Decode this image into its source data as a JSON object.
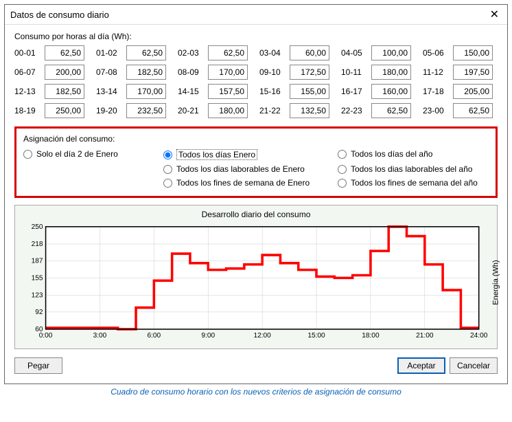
{
  "window": {
    "title": "Datos de consumo diario",
    "close": "✕"
  },
  "hourly": {
    "label": "Consumo por horas al día (Wh):",
    "rows": [
      {
        "h": "00-01",
        "v": "62,50"
      },
      {
        "h": "01-02",
        "v": "62,50"
      },
      {
        "h": "02-03",
        "v": "62,50"
      },
      {
        "h": "03-04",
        "v": "60,00"
      },
      {
        "h": "04-05",
        "v": "100,00"
      },
      {
        "h": "05-06",
        "v": "150,00"
      },
      {
        "h": "06-07",
        "v": "200,00"
      },
      {
        "h": "07-08",
        "v": "182,50"
      },
      {
        "h": "08-09",
        "v": "170,00"
      },
      {
        "h": "09-10",
        "v": "172,50"
      },
      {
        "h": "10-11",
        "v": "180,00"
      },
      {
        "h": "11-12",
        "v": "197,50"
      },
      {
        "h": "12-13",
        "v": "182,50"
      },
      {
        "h": "13-14",
        "v": "170,00"
      },
      {
        "h": "14-15",
        "v": "157,50"
      },
      {
        "h": "15-16",
        "v": "155,00"
      },
      {
        "h": "16-17",
        "v": "160,00"
      },
      {
        "h": "17-18",
        "v": "205,00"
      },
      {
        "h": "18-19",
        "v": "250,00"
      },
      {
        "h": "19-20",
        "v": "232,50"
      },
      {
        "h": "20-21",
        "v": "180,00"
      },
      {
        "h": "21-22",
        "v": "132,50"
      },
      {
        "h": "22-23",
        "v": "62,50"
      },
      {
        "h": "23-00",
        "v": "62,50"
      }
    ]
  },
  "assign": {
    "title": "Asignación del consumo:",
    "col1": [
      "Solo el día 2 de Enero"
    ],
    "col2": [
      "Todos los días Enero",
      "Todos los dias laborables de Enero",
      "Todos los fines de semana de Enero"
    ],
    "col3": [
      "Todos los días del año",
      "Todos los dias laborables del año",
      "Todos los fines de semana del año"
    ],
    "selected": "Todos los días Enero"
  },
  "chart_data": {
    "type": "line",
    "title": "Desarrollo diario del consumo",
    "ylabel": "Energía (Wh)",
    "xlabel": "",
    "xlim": [
      0,
      24
    ],
    "ylim": [
      60,
      250
    ],
    "xticks": [
      "0:00",
      "3:00",
      "6:00",
      "9:00",
      "12:00",
      "15:00",
      "18:00",
      "21:00",
      "24:00"
    ],
    "yticks": [
      60,
      92,
      123,
      155,
      187,
      218,
      250
    ],
    "x": [
      0,
      1,
      2,
      3,
      4,
      5,
      6,
      7,
      8,
      9,
      10,
      11,
      12,
      13,
      14,
      15,
      16,
      17,
      18,
      19,
      20,
      21,
      22,
      23,
      24
    ],
    "values": [
      62.5,
      62.5,
      62.5,
      62.5,
      60,
      100,
      150,
      200,
      182.5,
      170,
      172.5,
      180,
      197.5,
      182.5,
      170,
      157.5,
      155,
      160,
      205,
      250,
      232.5,
      180,
      132.5,
      62.5,
      62.5
    ]
  },
  "buttons": {
    "paste": "Pegar",
    "ok": "Aceptar",
    "cancel": "Cancelar"
  },
  "caption": "Cuadro de consumo horario con los nuevos criterios de asignación de consumo"
}
